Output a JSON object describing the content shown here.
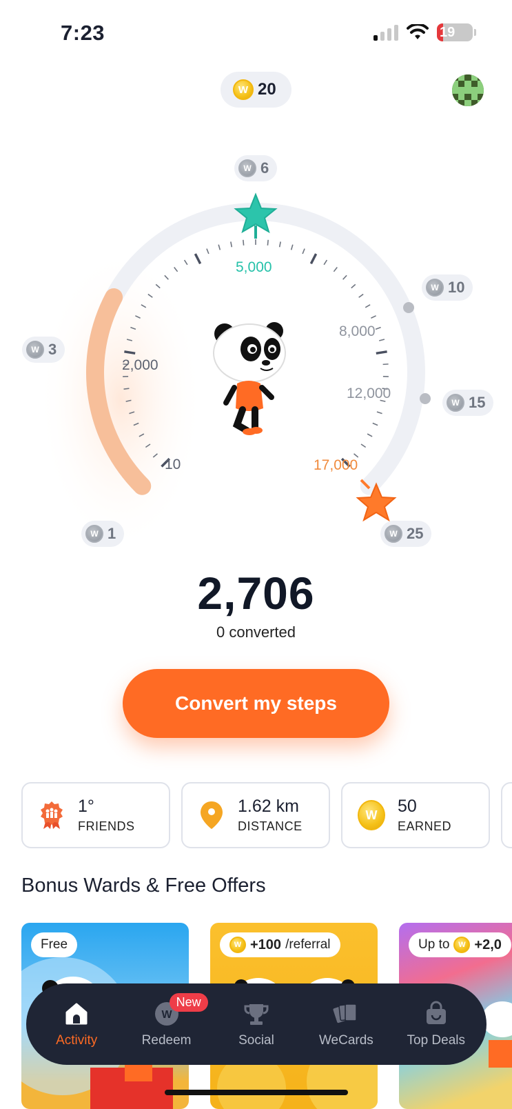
{
  "status_bar": {
    "time": "7:23",
    "battery": "19"
  },
  "header": {
    "coin_balance": "20"
  },
  "gauge": {
    "rewards": [
      "1",
      "3",
      "6",
      "10",
      "15",
      "25"
    ],
    "step_labels": [
      "10",
      "2,000",
      "5,000",
      "8,000",
      "12,000",
      "17,000"
    ],
    "progress_fraction": 0.27,
    "accent_teal": "#25c1a9",
    "accent_orange": "#ff7a2a"
  },
  "steps": {
    "value": "2,706",
    "converted": "0 converted"
  },
  "convert_button": {
    "label": "Convert my steps"
  },
  "stats": [
    {
      "value": "1°",
      "label": "FRIENDS",
      "icon": "friends-badge-icon"
    },
    {
      "value": "1.62 km",
      "label": "DISTANCE",
      "icon": "location-pin-icon"
    },
    {
      "value": "50",
      "label": "EARNED",
      "icon": "gold-coin-icon"
    }
  ],
  "section": {
    "title": "Bonus Wards & Free Offers"
  },
  "offers": [
    {
      "tag": "Free"
    },
    {
      "tag_amount": "+100",
      "tag_suffix": "/referral"
    },
    {
      "tag_prefix": "Up to",
      "tag_amount": "+2,0"
    }
  ],
  "nav": {
    "items": [
      {
        "label": "Activity",
        "icon": "home-icon",
        "active": true
      },
      {
        "label": "Redeem",
        "icon": "coin-icon",
        "badge": "New"
      },
      {
        "label": "Social",
        "icon": "trophy-icon"
      },
      {
        "label": "WeCards",
        "icon": "cards-icon"
      },
      {
        "label": "Top Deals",
        "icon": "shopping-bag-icon"
      }
    ]
  },
  "colors": {
    "brand": "#ff6b24",
    "nav_bg": "#1f2535"
  },
  "coin_symbol": "W"
}
